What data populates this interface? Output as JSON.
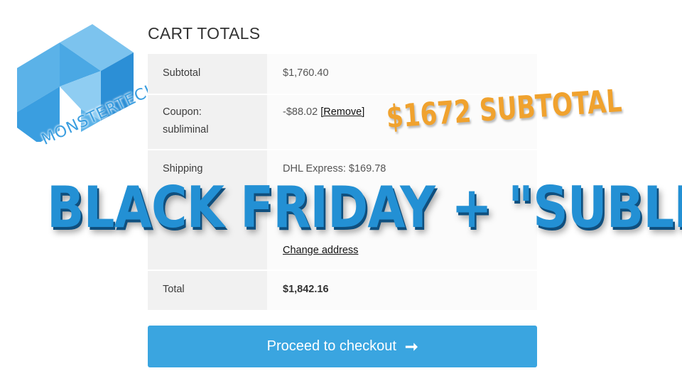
{
  "cart": {
    "title": "CART TOTALS",
    "rows": [
      {
        "label": "Subtotal",
        "value": "$1,760.40"
      },
      {
        "label_line1": "Coupon:",
        "label_line2": "subliminal",
        "value": "-$88.02",
        "link": "[Remove]"
      },
      {
        "label": "Shipping",
        "value": "DHL Express: $169.78",
        "link": "Change address"
      },
      {
        "label": "Total",
        "value": "$1,842.16"
      }
    ],
    "checkout_label": "Proceed to checkout",
    "checkout_arrow": "➞"
  },
  "overlay": {
    "headline": "BLACK FRIDAY + \"SUBLIMINAL\"",
    "subtotal_tag": "$1672 SUBTOTAL",
    "brand": "MONSTERTECH"
  },
  "colors": {
    "accent": "#3aa5e0",
    "headline": "#2390d4",
    "tag": "#f0a22e"
  }
}
